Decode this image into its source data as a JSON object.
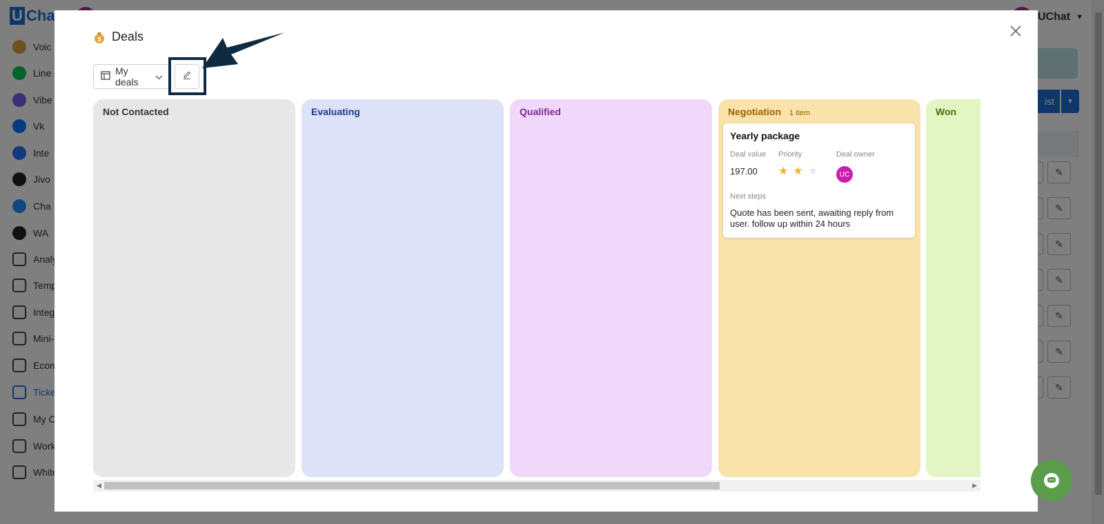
{
  "app": {
    "logo_text": "Chat",
    "logo_letter": "U",
    "account_name": "UChat",
    "sidebar": {
      "items": [
        {
          "label": "Voic",
          "icon": "voice-icon",
          "color": "#d9a23f"
        },
        {
          "label": "Line",
          "icon": "line-icon",
          "color": "#06c755"
        },
        {
          "label": "Vibe",
          "icon": "viber-icon",
          "color": "#7360f2"
        },
        {
          "label": "Vk",
          "icon": "vk-icon",
          "color": "#0077ff"
        },
        {
          "label": "Inte",
          "icon": "intercom-icon",
          "color": "#286efa"
        },
        {
          "label": "Jivo",
          "icon": "jivo-icon",
          "color": "#222222"
        },
        {
          "label": "Cha",
          "icon": "chatwoot-icon",
          "color": "#1f93ff"
        },
        {
          "label": "WA",
          "icon": "whatsapp-icon",
          "color": "#222222"
        },
        {
          "label": "Analy",
          "icon": "analytics-icon",
          "color": "#444444"
        },
        {
          "label": "Temp",
          "icon": "templates-icon",
          "color": "#444444"
        },
        {
          "label": "Integ",
          "icon": "integrations-icon",
          "color": "#444444"
        },
        {
          "label": "Mini-A",
          "icon": "mini-app-icon",
          "color": "#444444"
        },
        {
          "label": "Ecom",
          "icon": "ecommerce-icon",
          "color": "#444444"
        },
        {
          "label": "Ticke",
          "icon": "tickets-icon",
          "color": "#1e6fd9"
        },
        {
          "label": "My Co",
          "icon": "my-contents-icon",
          "color": "#444444"
        },
        {
          "label": "Works",
          "icon": "workspace-icon",
          "color": "#444444"
        },
        {
          "label": "White",
          "icon": "white-label-icon",
          "color": "#444444"
        }
      ]
    },
    "bg_button_label": "ist"
  },
  "modal": {
    "title": "Deals",
    "title_icon": "money-bag-icon",
    "view_select": {
      "icon": "board-view-icon",
      "value": "My deals"
    },
    "edit_button_icon": "pencil-icon",
    "columns": [
      {
        "name": "Not Contacted",
        "count": "",
        "bg": "#e7e7e7",
        "color": "#333333"
      },
      {
        "name": "Evaluating",
        "count": "",
        "bg": "#dde2f8",
        "color": "#1c3a8c"
      },
      {
        "name": "Qualified",
        "count": "",
        "bg": "#f1d8fa",
        "color": "#7a2a8c"
      },
      {
        "name": "Negotiation",
        "count": "1 item",
        "bg": "#fae2ab",
        "color": "#9a6200"
      },
      {
        "name": "Won",
        "count": "",
        "bg": "#e3f5c2",
        "color": "#4a6b12"
      }
    ],
    "card": {
      "title": "Yearly package",
      "deal_value_label": "Deal value",
      "deal_value": "197.00",
      "priority_label": "Priority",
      "priority": {
        "value": 2,
        "max": 3
      },
      "owner_label": "Deal owner",
      "owner_initials": "UC",
      "next_steps_label": "Next steps",
      "next_steps": "Quote has been sent, awaiting reply from user. follow up within 24 hours"
    }
  },
  "chat_widget_icon": "chat-bubble-icon"
}
